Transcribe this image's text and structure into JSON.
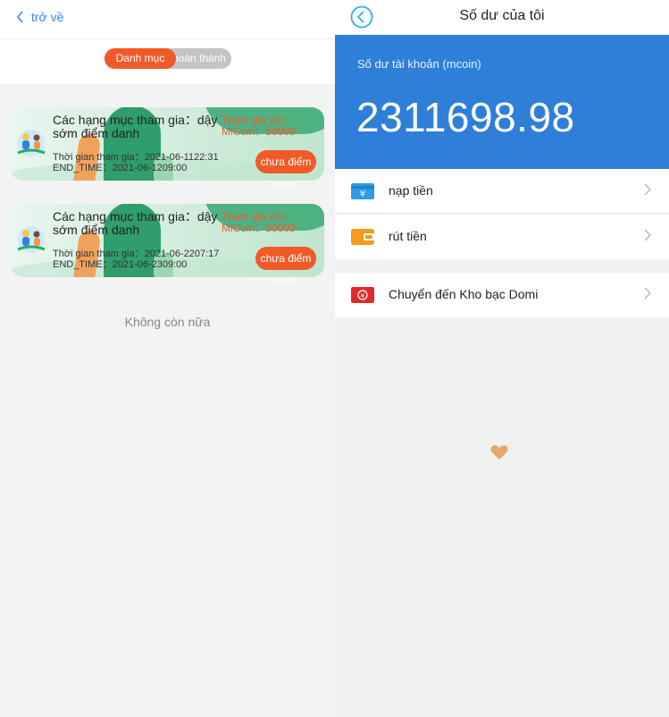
{
  "left": {
    "back_label": "trở về",
    "tabs": [
      "Danh mục",
      "hoàn thành"
    ],
    "cards": [
      {
        "title": "Các hạng mục tham gia：dậy sớm điểm danh",
        "reward_line1": "Tham gia vào",
        "reward_line2": "MiCoin：50000",
        "time_line": "Thời gian tham gia：2021-06-1122:31",
        "end_line": "END_TIME：2021-06-1209:00",
        "button": "chưa điểm",
        "button_overflow": "danh"
      },
      {
        "title": "Các hạng mục tham gia：dậy sớm điểm danh",
        "reward_line1": "Tham gia vào",
        "reward_line2": "MiCoin：50000",
        "time_line": "Thời gian tham gia：2021-06-2207:17",
        "end_line": "END_TIME：2021-06-2309:00",
        "button": "chưa điểm",
        "button_overflow": "danh"
      }
    ],
    "no_more": "Không còn nữa"
  },
  "right": {
    "title": "Số dư của tôi",
    "balance_label": "Số dư tài khoản (mcoin)",
    "balance_value": "2311698.98",
    "menu": [
      {
        "label": "nạp tiền",
        "icon": "yen-card-icon",
        "color": "#2f9be8"
      },
      {
        "label": "rút tiền",
        "icon": "wallet-icon",
        "color": "#f59a1b"
      },
      {
        "label": "Chuyển đến Kho bạc Domi",
        "icon": "treasury-icon",
        "color": "#e02b2b"
      }
    ]
  },
  "colors": {
    "accent": "#f05a28",
    "blue": "#2f7fd8",
    "link": "#3b82f6"
  }
}
